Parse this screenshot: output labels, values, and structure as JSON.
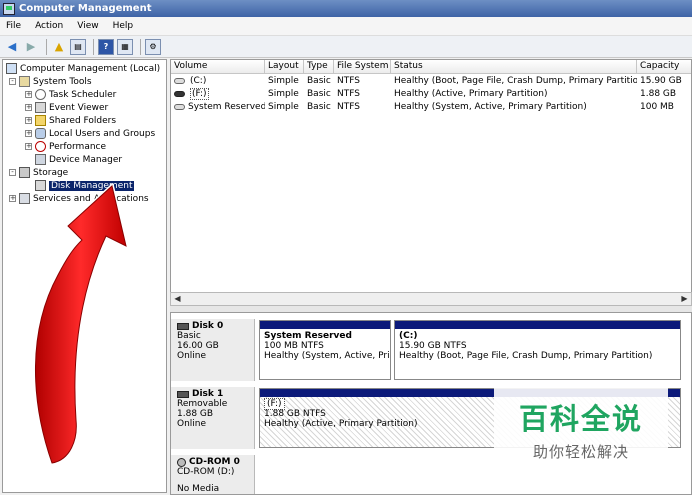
{
  "window": {
    "title": "Computer Management"
  },
  "menu": [
    "File",
    "Action",
    "View",
    "Help"
  ],
  "tree": {
    "root": "Computer Management (Local)",
    "system_tools": "System Tools",
    "task_scheduler": "Task Scheduler",
    "event_viewer": "Event Viewer",
    "shared_folders": "Shared Folders",
    "local_users": "Local Users and Groups",
    "performance": "Performance",
    "device_manager": "Device Manager",
    "storage": "Storage",
    "disk_management": "Disk Management",
    "services": "Services and Applications"
  },
  "volumes": {
    "columns": [
      "Volume",
      "Layout",
      "Type",
      "File System",
      "Status",
      "Capacity"
    ],
    "rows": [
      [
        "(C:)",
        "Simple",
        "Basic",
        "NTFS",
        "Healthy (Boot, Page File, Crash Dump, Primary Partition)",
        "15.90 GB"
      ],
      [
        "(F:)",
        "Simple",
        "Basic",
        "NTFS",
        "Healthy (Active, Primary Partition)",
        "1.88 GB"
      ],
      [
        "System Reserved",
        "Simple",
        "Basic",
        "NTFS",
        "Healthy (System, Active, Primary Partition)",
        "100 MB"
      ]
    ]
  },
  "disks": {
    "disk0": {
      "name": "Disk 0",
      "type": "Basic",
      "size": "16.00 GB",
      "state": "Online",
      "p1": {
        "name": "System Reserved",
        "size": "100 MB NTFS",
        "status": "Healthy (System, Active, Prin"
      },
      "p2": {
        "name": "(C:)",
        "size": "15.90 GB NTFS",
        "status": "Healthy (Boot, Page File, Crash Dump, Primary Partition)"
      }
    },
    "disk1": {
      "name": "Disk 1",
      "type": "Removable",
      "size": "1.88 GB",
      "state": "Online",
      "p1": {
        "name": "(F:)",
        "size": "1.88 GB NTFS",
        "status": "Healthy (Active, Primary Partition)"
      }
    },
    "cdrom0": {
      "name": "CD-ROM 0",
      "drive": "CD-ROM (D:)",
      "media": "No Media"
    }
  },
  "watermark": {
    "title": "百科全说",
    "subtitle": "助你轻松解决"
  },
  "colors": {
    "title_bar": "#3e63a6",
    "partition_band": "#0c1a7a",
    "selection": "#0a246a",
    "arrow": "#e01010",
    "watermark_green": "#1fa560"
  }
}
